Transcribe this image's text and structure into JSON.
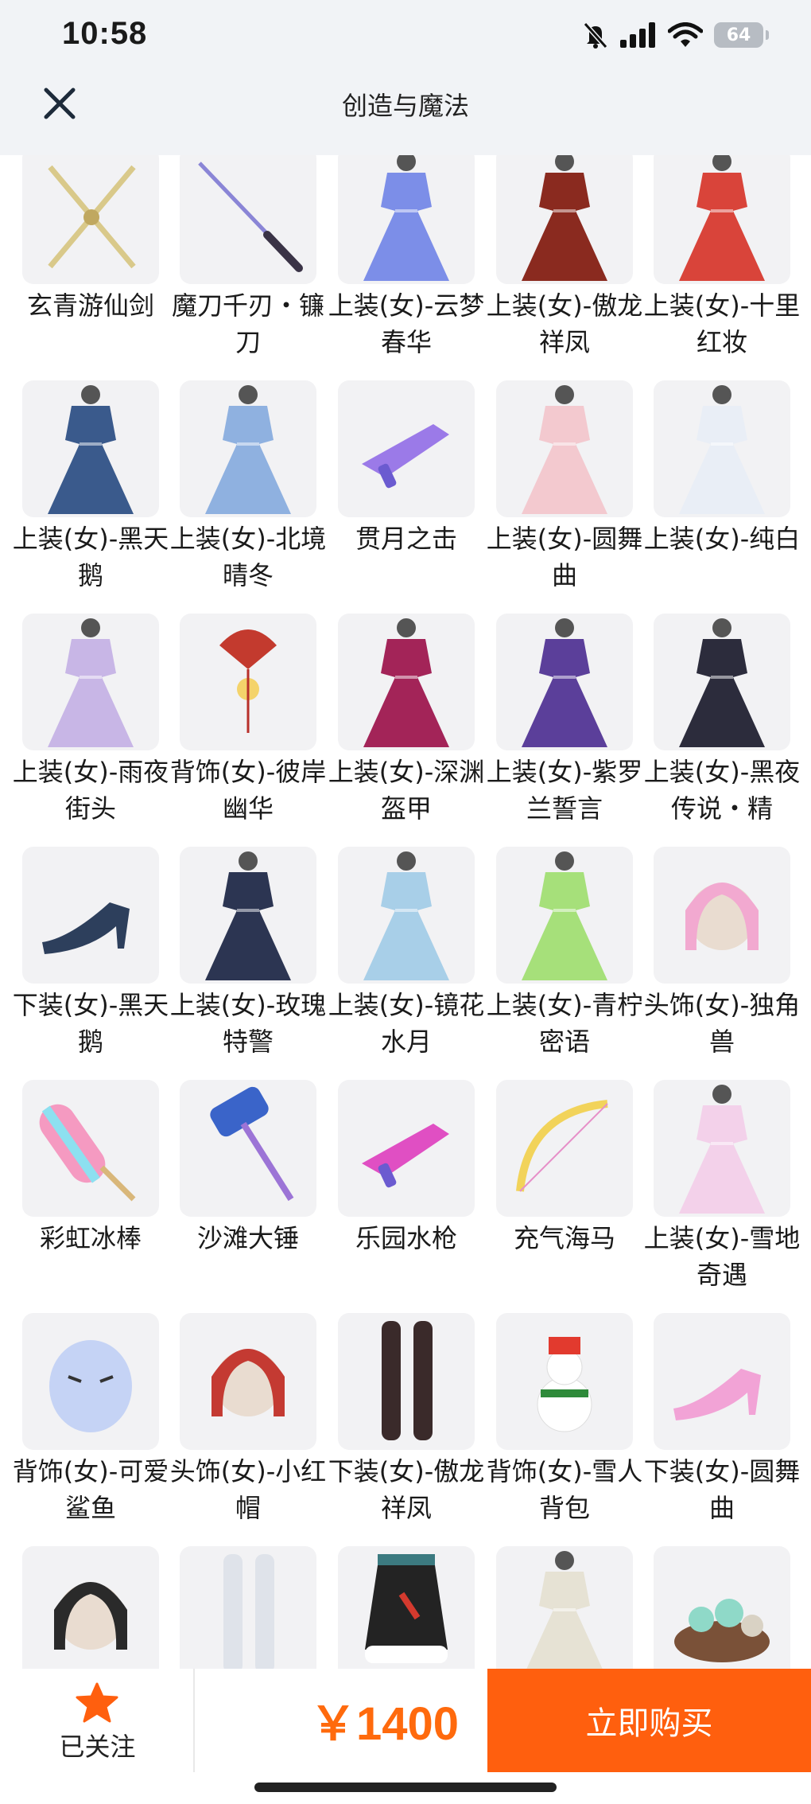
{
  "status_bar": {
    "time": "10:58",
    "battery": "64"
  },
  "header": {
    "title": "创造与魔法"
  },
  "items": [
    {
      "label": "玄青游仙剑",
      "icon": "crossed-swords",
      "color": "#d9c98a"
    },
    {
      "label": "魔刀千刃・镰刀",
      "icon": "katana",
      "color": "#3a3346"
    },
    {
      "label": "上装(女)-云梦春华",
      "icon": "gown",
      "color": "#7c8ee8"
    },
    {
      "label": "上装(女)-傲龙祥凤",
      "icon": "gown",
      "color": "#8a2a1f"
    },
    {
      "label": "上装(女)-十里红妆",
      "icon": "gown",
      "color": "#d9443a"
    },
    {
      "label": "上装(女)-黑天鹅",
      "icon": "gown",
      "color": "#3a5a8c"
    },
    {
      "label": "上装(女)-北境晴冬",
      "icon": "gown",
      "color": "#8fb1e0"
    },
    {
      "label": "贯月之击",
      "icon": "gun",
      "color": "#9b7ae8"
    },
    {
      "label": "上装(女)-圆舞曲",
      "icon": "gown",
      "color": "#f3c9cf"
    },
    {
      "label": "上装(女)-纯白",
      "icon": "gown",
      "color": "#e9eef6"
    },
    {
      "label": "上装(女)-雨夜街头",
      "icon": "gown",
      "color": "#c8b6e6"
    },
    {
      "label": "背饰(女)-彼岸幽华",
      "icon": "fan",
      "color": "#c33a2e"
    },
    {
      "label": "上装(女)-深渊盔甲",
      "icon": "gown",
      "color": "#a32458"
    },
    {
      "label": "上装(女)-紫罗兰誓言",
      "icon": "gown",
      "color": "#5b3f9a"
    },
    {
      "label": "上装(女)-黑夜传说・精",
      "icon": "gown",
      "color": "#2c2c3c"
    },
    {
      "label": "下装(女)-黑天鹅",
      "icon": "heels",
      "color": "#2d3f5c"
    },
    {
      "label": "上装(女)-玫瑰特警",
      "icon": "gown",
      "color": "#2c3552"
    },
    {
      "label": "上装(女)-镜花水月",
      "icon": "gown",
      "color": "#a8cfe8"
    },
    {
      "label": "上装(女)-青柠密语",
      "icon": "gown",
      "color": "#a6e07a"
    },
    {
      "label": "头饰(女)-独角兽",
      "icon": "head",
      "color": "#f2a9d0"
    },
    {
      "label": "彩虹冰棒",
      "icon": "popsicle",
      "color": "#f59ac1"
    },
    {
      "label": "沙滩大锤",
      "icon": "hammer",
      "color": "#3a64c9"
    },
    {
      "label": "乐园水枪",
      "icon": "gun",
      "color": "#e04fc3"
    },
    {
      "label": "充气海马",
      "icon": "bow",
      "color": "#f2d35a"
    },
    {
      "label": "上装(女)-雪地奇遇",
      "icon": "gown",
      "color": "#f3d1ea"
    },
    {
      "label": "背饰(女)-可爱鲨鱼",
      "icon": "shark",
      "color": "#c5d3f5"
    },
    {
      "label": "头饰(女)-小红帽",
      "icon": "head",
      "color": "#c43a32"
    },
    {
      "label": "下装(女)-傲龙祥凤",
      "icon": "stockings",
      "color": "#3a2a2a"
    },
    {
      "label": "背饰(女)-雪人背包",
      "icon": "snowman",
      "color": "#e23a2e"
    },
    {
      "label": "下装(女)-圆舞曲",
      "icon": "heels",
      "color": "#f2a3d6"
    },
    {
      "label": "",
      "icon": "head",
      "color": "#2a2a2a"
    },
    {
      "label": "",
      "icon": "stockings",
      "color": "#dfe3ea"
    },
    {
      "label": "",
      "icon": "skirt",
      "color": "#232323"
    },
    {
      "label": "",
      "icon": "gown",
      "color": "#e6e2d4"
    },
    {
      "label": "",
      "icon": "rock",
      "color": "#8fd9c8"
    }
  ],
  "bottom": {
    "follow_label": "已关注",
    "price": "￥1400",
    "buy_label": "立即购买"
  },
  "colors": {
    "accent": "#ff5f0e",
    "price": "#ff6a0d",
    "header_bg": "#f1f3f6"
  }
}
